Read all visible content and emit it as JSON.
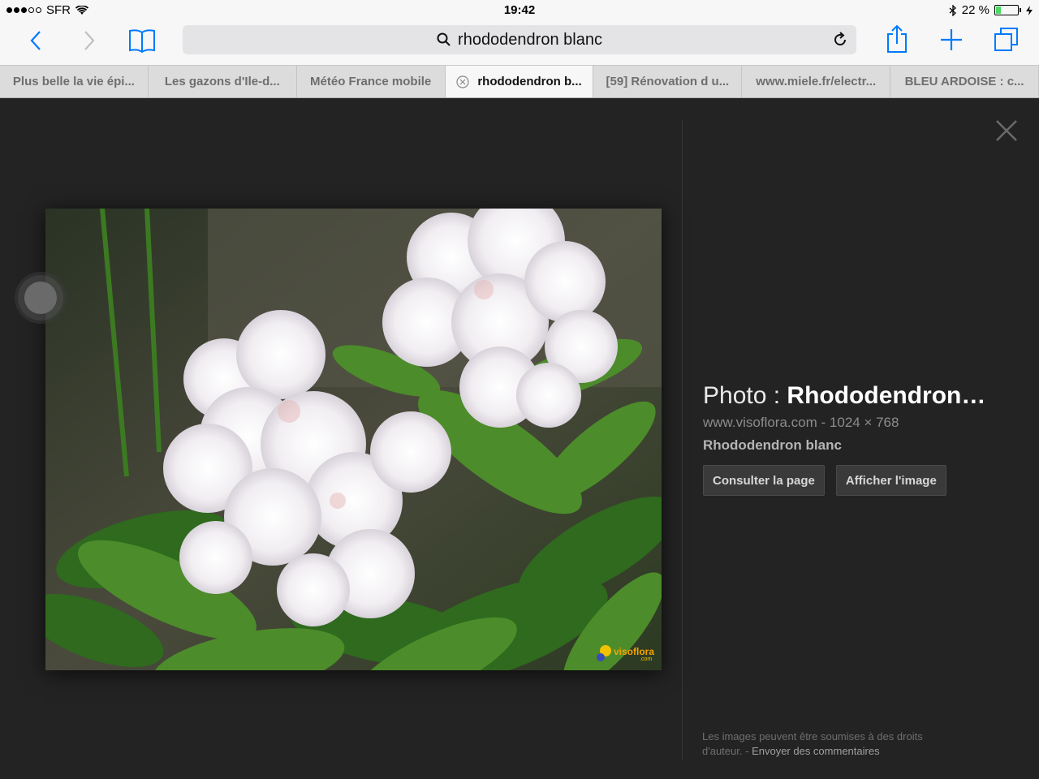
{
  "status_bar": {
    "carrier": "SFR",
    "time": "19:42",
    "battery_label": "22 %",
    "battery_level": 0.22,
    "signal_bars": [
      true,
      true,
      true,
      false,
      false
    ]
  },
  "toolbar": {
    "search_text": "rhododendron blanc"
  },
  "tabs": [
    {
      "label": "Plus belle la vie épi..."
    },
    {
      "label": "Les gazons d'Ile-d..."
    },
    {
      "label": "Météo France mobile"
    },
    {
      "label": "rhododendron b...",
      "active": true
    },
    {
      "label": "[59] Rénovation d u..."
    },
    {
      "label": "www.miele.fr/electr..."
    },
    {
      "label": "BLEU ARDOISE : c..."
    }
  ],
  "viewer": {
    "title_prefix": "Photo : ",
    "title_bold": "Rhododendron…",
    "source": "www.visoflora.com",
    "separator": "-",
    "dimensions": "1024 × 768",
    "caption": "Rhododendron blanc",
    "visit_page_label": "Consulter la page",
    "view_image_label": "Afficher l'image",
    "watermark": "visoflora",
    "watermark_sub": ".com",
    "footer_text": "Les images peuvent être soumises à des droits d'auteur.",
    "footer_sep": "-",
    "feedback_label": "Envoyer des commentaires"
  },
  "colors": {
    "accent": "#007aff",
    "battery": "#4cd964",
    "viewer_bg": "#232323"
  }
}
